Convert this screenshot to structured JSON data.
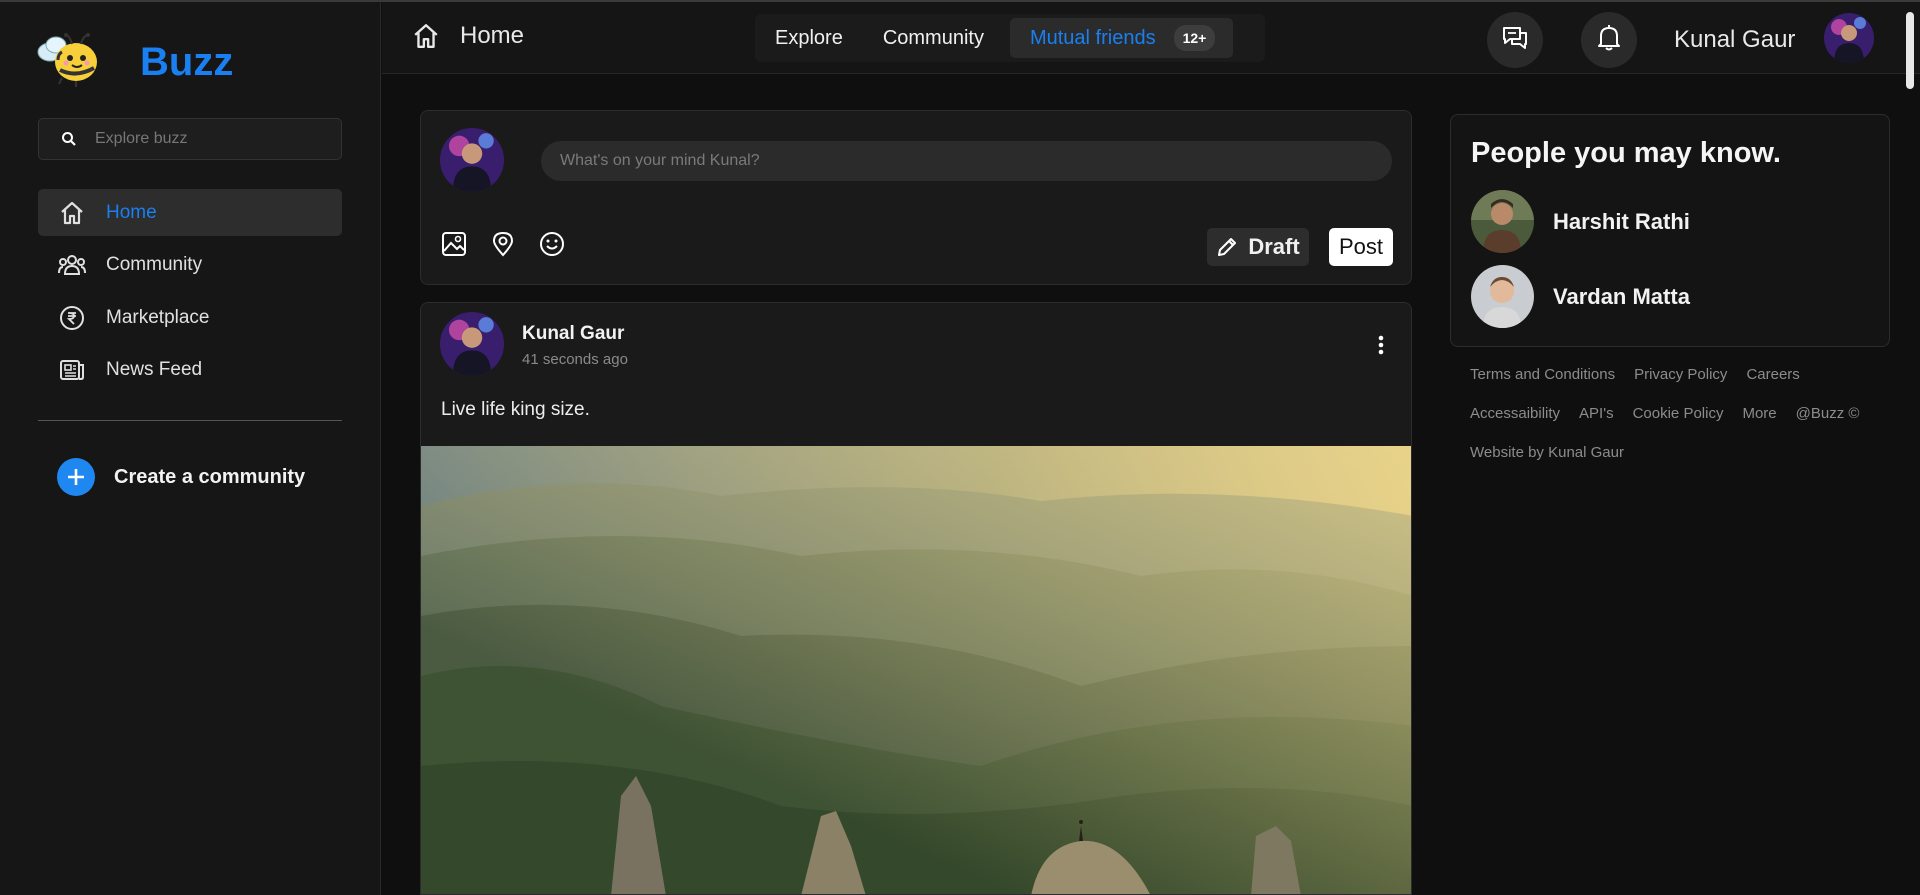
{
  "sidebar": {
    "brand": "Buzz",
    "search_placeholder": "Explore buzz",
    "items": [
      {
        "label": "Home",
        "icon": "home-icon",
        "active": true
      },
      {
        "label": "Community",
        "icon": "community-icon"
      },
      {
        "label": "Marketplace",
        "icon": "rupee-icon"
      },
      {
        "label": "News Feed",
        "icon": "newsfeed-icon"
      }
    ],
    "create_label": "Create a community"
  },
  "header": {
    "title": "Home",
    "tabs": [
      {
        "label": "Explore"
      },
      {
        "label": "Community"
      },
      {
        "label": "Mutual friends",
        "badge": "12+",
        "active": true
      }
    ],
    "user_name": "Kunal Gaur"
  },
  "composer": {
    "placeholder": "What's on your mind Kunal?",
    "draft_label": "Draft",
    "post_label": "Post"
  },
  "post": {
    "author": "Kunal Gaur",
    "time": "41 seconds ago",
    "text": "Live life king size."
  },
  "people": {
    "title": "People you may know.",
    "list": [
      {
        "name": "Harshit Rathi"
      },
      {
        "name": "Vardan Matta"
      }
    ]
  },
  "footer": {
    "row1": [
      "Terms and Conditions",
      "Privacy Policy",
      "Careers"
    ],
    "row2": [
      "Accessaibility",
      "API's",
      "Cookie Policy",
      "More",
      "@Buzz ©"
    ],
    "row3": [
      "Website by Kunal Gaur"
    ]
  },
  "colors": {
    "accent": "#1a7ff0",
    "background": "#0f0f0f",
    "panel": "#1a1a1a"
  }
}
